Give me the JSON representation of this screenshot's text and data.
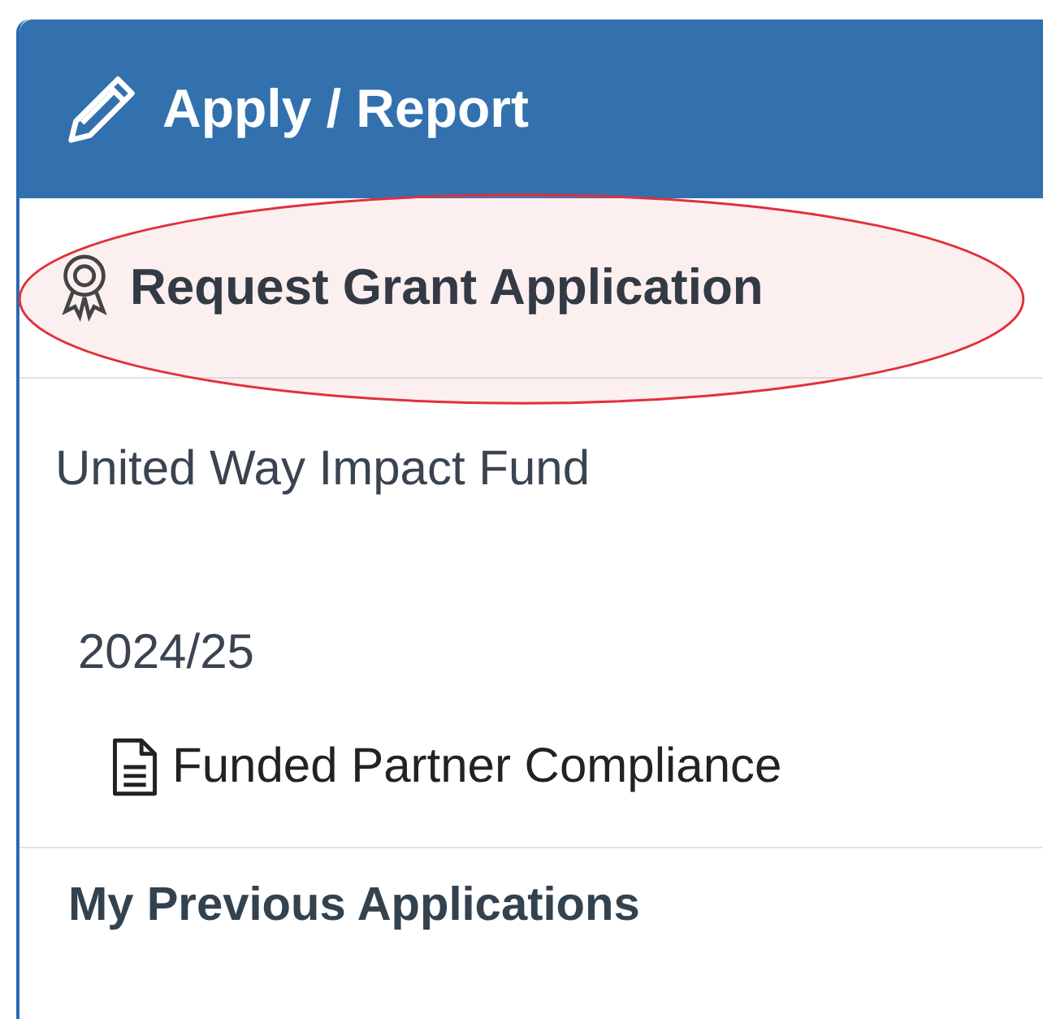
{
  "panel": {
    "title": "Apply / Report"
  },
  "sections": [
    {
      "kind": "action",
      "label": "Request Grant Application",
      "highlighted": true
    },
    {
      "kind": "fund",
      "label": "United Way Impact Fund",
      "children": [
        {
          "kind": "period",
          "label": "2024/25",
          "children": [
            {
              "kind": "document",
              "label": "Funded Partner Compliance"
            }
          ]
        }
      ]
    },
    {
      "kind": "heading",
      "label": "My Previous Applications"
    }
  ]
}
